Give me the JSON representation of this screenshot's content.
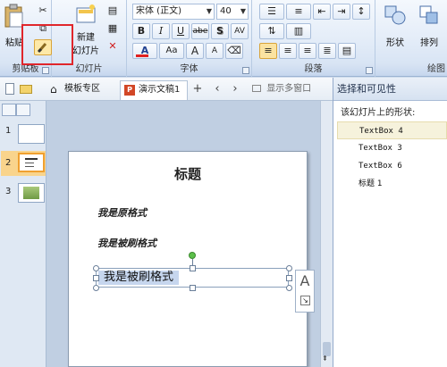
{
  "ribbon": {
    "clipboard": {
      "paste_label": "粘贴",
      "group_label": "剪贴板"
    },
    "slides": {
      "new_slide_label_line1": "新建",
      "new_slide_label_line2": "幻灯片",
      "group_label": "幻灯片"
    },
    "font": {
      "font_name": "宋体 (正文)",
      "font_size": "40",
      "bold": "B",
      "italic": "I",
      "underline": "U",
      "strike": "abe",
      "shadow": "S",
      "char_spacing": "AV",
      "font_color": "A",
      "change_case": "Aa",
      "grow": "A",
      "shrink": "A",
      "group_label": "字体"
    },
    "paragraph": {
      "group_label": "段落"
    },
    "drawing": {
      "shape_label": "形状",
      "arrange_label": "排列",
      "group_label": "绘图"
    }
  },
  "tabs": {
    "home_tab": "模板专区",
    "doc_tab": "演示文稿1",
    "multi_window": "显示多窗口"
  },
  "slides_pane": {
    "numbers": [
      "1",
      "2",
      "3"
    ]
  },
  "slide": {
    "title": "标题",
    "line1": "我是原格式",
    "line2": "我是被刷格式",
    "selected_text": "我是被刷格式",
    "autofit_glyph": "A"
  },
  "selection_pane": {
    "title": "选择和可见性",
    "subtitle": "该幻灯片上的形状:",
    "shapes": [
      "TextBox 4",
      "TextBox 3",
      "TextBox 6",
      "标题 1"
    ]
  },
  "colors": {
    "highlight": "#e0262b",
    "font_color_bar": "#e02020",
    "selection": "#c6d6ee"
  }
}
